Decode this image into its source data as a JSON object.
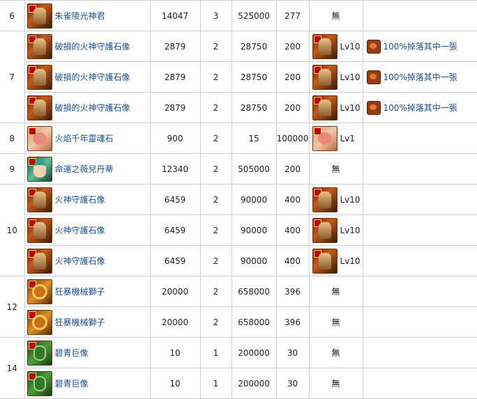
{
  "rows": [
    {
      "group": "6",
      "name": "朱雀陵光神君",
      "hp": "14047",
      "cd": "3",
      "atk": "525000",
      "def": "277",
      "drop": "無",
      "drop_lv": "",
      "card": "",
      "avatar": "fire"
    },
    {
      "group": "7",
      "name": "破損的火神守護石像",
      "hp": "2879",
      "cd": "2",
      "atk": "28750",
      "def": "200",
      "drop": "",
      "drop_lv": "Lv10",
      "card": "100%掉落其中一張",
      "avatar": "fire"
    },
    {
      "group": "",
      "name": "破損的火神守護石像",
      "hp": "2879",
      "cd": "2",
      "atk": "28750",
      "def": "200",
      "drop": "",
      "drop_lv": "Lv10",
      "card": "100%掉落其中一張",
      "avatar": "fire"
    },
    {
      "group": "",
      "name": "破損的火神守護石像",
      "hp": "2879",
      "cd": "2",
      "atk": "28750",
      "def": "200",
      "drop": "",
      "drop_lv": "Lv10",
      "card": "100%掉落其中一張",
      "avatar": "fire"
    },
    {
      "group": "8",
      "name": "火焰千年靈魂石",
      "hp": "900",
      "cd": "2",
      "atk": "15",
      "def": "100000",
      "drop": "",
      "drop_lv": "Lv1",
      "card": "",
      "avatar": "pink"
    },
    {
      "group": "9",
      "name": "命運之薇兒丹蒂",
      "hp": "12340",
      "cd": "2",
      "atk": "505000",
      "def": "200",
      "drop": "無",
      "drop_lv": "",
      "card": "",
      "avatar": "teal"
    },
    {
      "group": "10",
      "name": "火神守護石像",
      "hp": "6459",
      "cd": "2",
      "atk": "90000",
      "def": "400",
      "drop": "",
      "drop_lv": "Lv10",
      "card": "",
      "avatar": "fire"
    },
    {
      "group": "",
      "name": "火神守護石像",
      "hp": "6459",
      "cd": "2",
      "atk": "90000",
      "def": "400",
      "drop": "",
      "drop_lv": "Lv10",
      "card": "",
      "avatar": "fire"
    },
    {
      "group": "",
      "name": "火神守護石像",
      "hp": "6459",
      "cd": "2",
      "atk": "90000",
      "def": "400",
      "drop": "",
      "drop_lv": "Lv10",
      "card": "",
      "avatar": "fire"
    },
    {
      "group": "12",
      "name": "狂暴機械獅子",
      "hp": "20000",
      "cd": "2",
      "atk": "658000",
      "def": "396",
      "drop": "無",
      "drop_lv": "",
      "card": "",
      "avatar": "lion"
    },
    {
      "group": "",
      "name": "狂暴機械獅子",
      "hp": "20000",
      "cd": "2",
      "atk": "658000",
      "def": "396",
      "drop": "無",
      "drop_lv": "",
      "card": "",
      "avatar": "lion"
    },
    {
      "group": "14",
      "name": "碧青巨像",
      "hp": "10",
      "cd": "1",
      "atk": "200000",
      "def": "30",
      "drop": "無",
      "drop_lv": "",
      "card": "",
      "avatar": "green"
    },
    {
      "group": "",
      "name": "碧青巨像",
      "hp": "10",
      "cd": "1",
      "atk": "200000",
      "def": "30",
      "drop": "無",
      "drop_lv": "",
      "card": "",
      "avatar": "green"
    }
  ],
  "spans": {
    "6": 1,
    "7": 3,
    "8": 1,
    "9": 1,
    "10": 3,
    "12": 2,
    "14": 2
  }
}
